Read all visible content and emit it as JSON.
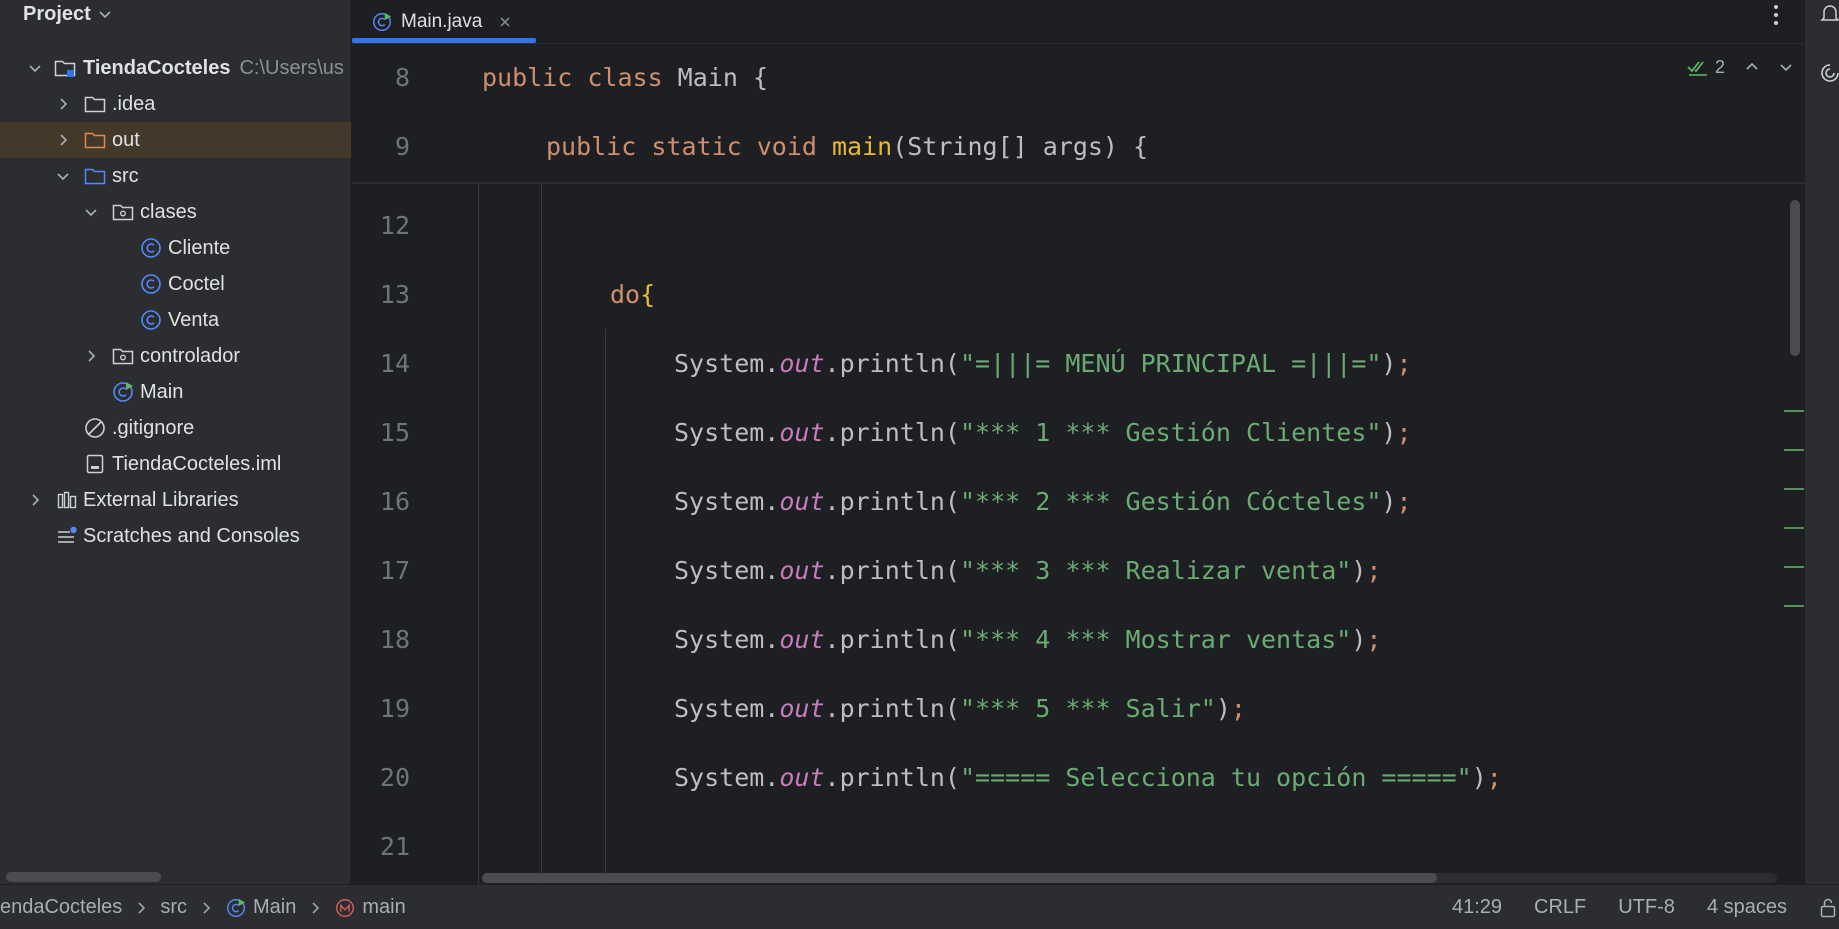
{
  "project_panel": {
    "title": "Project",
    "tree": [
      {
        "label": "TiendaCocteles",
        "path": "C:\\Users\\us",
        "icon": "module-folder-icon"
      },
      {
        "label": ".idea",
        "icon": "folder-icon"
      },
      {
        "label": "out",
        "icon": "excluded-folder-icon"
      },
      {
        "label": "src",
        "icon": "source-folder-icon"
      },
      {
        "label": "clases",
        "icon": "package-icon"
      },
      {
        "label": "Cliente",
        "icon": "class-icon"
      },
      {
        "label": "Coctel",
        "icon": "class-icon"
      },
      {
        "label": "Venta",
        "icon": "class-icon"
      },
      {
        "label": "controlador",
        "icon": "package-icon"
      },
      {
        "label": "Main",
        "icon": "main-class-icon"
      },
      {
        "label": ".gitignore",
        "icon": "ignore-file-icon"
      },
      {
        "label": "TiendaCocteles.iml",
        "icon": "iml-file-icon"
      },
      {
        "label": "External Libraries",
        "icon": "libraries-icon"
      },
      {
        "label": "Scratches and Consoles",
        "icon": "scratches-icon"
      }
    ]
  },
  "editor": {
    "tab": {
      "label": "Main.java"
    },
    "inspection": {
      "count": "2"
    },
    "sticky_lines": [
      {
        "num": "8",
        "kw": "public class ",
        "name": "Main",
        "rest": " {"
      },
      {
        "num": "9",
        "kw": "public static void ",
        "fn": "main",
        "rest": "(String[] args) {"
      }
    ],
    "lines": [
      {
        "num": "12"
      },
      {
        "num": "13",
        "kw": "do",
        "brace": "{"
      },
      {
        "num": "14",
        "obj": "System.",
        "field": "out",
        "call": ".println(",
        "str": "\"=|||= MENÚ PRINCIPAL =|||=\"",
        "end": ")",
        "semi": ";"
      },
      {
        "num": "15",
        "obj": "System.",
        "field": "out",
        "call": ".println(",
        "str": "\"*** 1 *** Gestión Clientes\"",
        "end": ")",
        "semi": ";"
      },
      {
        "num": "16",
        "obj": "System.",
        "field": "out",
        "call": ".println(",
        "str": "\"*** 2 *** Gestión Cócteles\"",
        "end": ")",
        "semi": ";"
      },
      {
        "num": "17",
        "obj": "System.",
        "field": "out",
        "call": ".println(",
        "str": "\"*** 3 *** Realizar venta\"",
        "end": ")",
        "semi": ";"
      },
      {
        "num": "18",
        "obj": "System.",
        "field": "out",
        "call": ".println(",
        "str": "\"*** 4 *** Mostrar ventas\"",
        "end": ")",
        "semi": ";"
      },
      {
        "num": "19",
        "obj": "System.",
        "field": "out",
        "call": ".println(",
        "str": "\"*** 5 *** Salir\"",
        "end": ")",
        "semi": ";"
      },
      {
        "num": "20",
        "obj": "System.",
        "field": "out",
        "call": ".println(",
        "str": "\"===== Selecciona tu opción =====\"",
        "end": ")",
        "semi": ";"
      },
      {
        "num": "21"
      }
    ]
  },
  "statusbar": {
    "breadcrumbs": [
      "endaCocteles",
      "src",
      "Main",
      "main"
    ],
    "position": "41:29",
    "line_separator": "CRLF",
    "encoding": "UTF-8",
    "indent": "4 spaces"
  },
  "colors": {
    "accent": "#3574f0",
    "keyword": "#cf8e6d",
    "string": "#6aab73",
    "field": "#c77dbb",
    "selection": "#43392b"
  }
}
